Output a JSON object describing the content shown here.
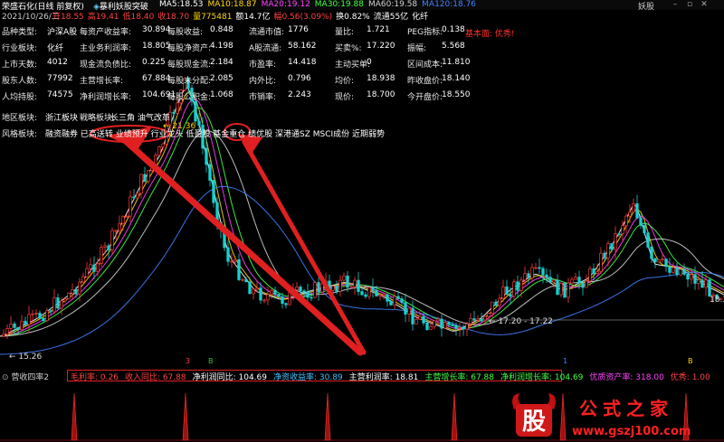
{
  "window": {
    "title": "荣盛石化(日线 前复权)",
    "formula_name": "暴利妖股突破",
    "ma": [
      {
        "label": "MA5:",
        "value": "18.53",
        "color": "#ffffff"
      },
      {
        "label": "MA10:",
        "value": "18.87",
        "color": "#ffd700"
      },
      {
        "label": "MA20:",
        "value": "19.12",
        "color": "#ff40ff"
      },
      {
        "label": "MA30:",
        "value": "19.88",
        "color": "#40ff40"
      },
      {
        "label": "MA60:",
        "value": "19.58",
        "color": "#d0d0d0"
      },
      {
        "label": "MA120:",
        "value": "18.76",
        "color": "#4080ff"
      }
    ],
    "app_name": "妖股",
    "buttons": [
      "minimize",
      "restore",
      "close"
    ]
  },
  "infobar": {
    "date": "2021/10/26/二",
    "items": [
      {
        "text": "开18.55",
        "color": "#ff4040"
      },
      {
        "text": "高19.41",
        "color": "#ff4040"
      },
      {
        "text": "低18.40",
        "color": "#ff4040"
      },
      {
        "text": "收18.70",
        "color": "#ff4040"
      },
      {
        "text": "量775481",
        "color": "#ffd700"
      },
      {
        "text": "额14.7亿",
        "color": "#ffffff"
      },
      {
        "text": "幅0.56(3.09%)",
        "color": "#ff4040"
      },
      {
        "text": "换0.82%",
        "color": "#ffffff"
      },
      {
        "text": "流通55亿",
        "color": "#ffffff"
      },
      {
        "text": "化纤",
        "color": "#ffffff"
      }
    ]
  },
  "fundamentals": {
    "rows": [
      [
        [
          "品种类型:",
          "沪深A股"
        ],
        [
          "每资产收益率:",
          "30.894"
        ],
        [
          "每股收益:",
          "0.848"
        ],
        [
          "流通市值:",
          "1776"
        ],
        [
          "量比:",
          "1.721"
        ],
        [
          "PEG指标:",
          "0.138"
        ]
      ],
      [
        [
          "行业板块:",
          "化纤"
        ],
        [
          "主业务利润率:",
          "18.805"
        ],
        [
          "每股净资产:",
          "4.198"
        ],
        [
          "A股流通:",
          "58.162"
        ],
        [
          "买卖%:",
          "17.220"
        ],
        [
          "振幅:",
          "5.568"
        ]
      ],
      [
        [
          "上市天数:",
          "4012"
        ],
        [
          "现金流负债比:",
          "0.225"
        ],
        [
          "每股现金流:",
          "2.184"
        ],
        [
          "市盈率:",
          "14.418"
        ],
        [
          "主动买单:",
          "0"
        ],
        [
          "区间成本:",
          "11.810"
        ]
      ],
      [
        [
          "股东人数:",
          "77992"
        ],
        [
          "主营增长率:",
          "67.884"
        ],
        [
          "每股未分配:",
          "2.085"
        ],
        [
          "内外比:",
          "0.796"
        ],
        [
          "均价:",
          "18.938"
        ],
        [
          "昨收盘价:",
          "18.140"
        ]
      ],
      [
        [
          "人均持股:",
          "74575"
        ],
        [
          "净利润增长率:",
          "104.691"
        ],
        [
          "每股公积金:",
          "1.068"
        ],
        [
          "市销率:",
          "2.243"
        ],
        [
          "现价:",
          "18.700"
        ],
        [
          "今开盘价:",
          "18.550"
        ]
      ]
    ],
    "region": {
      "label": "地区板块:",
      "value": "浙江板块",
      "strategy_label": "戦略板块:",
      "strategy_value": "长三角 油气改革"
    },
    "style": {
      "label": "风格板块:",
      "value": "融资融券 已高送转 业绩预升 行业龙头 低盈股 基金重仓 绩优股 深港通SZ MSCI成份 近期弱势"
    }
  },
  "basic_face": "基本面: 优秀!",
  "chart_data": {
    "type": "candlestick",
    "price_labels": [
      "21.36",
      "17.20 - 17.22",
      "15.26",
      "18.3"
    ],
    "markers": [
      "3",
      "1",
      "B",
      "B"
    ],
    "annotations": [
      "行业龙头",
      "绩优股"
    ]
  },
  "sub_indicator": {
    "name": "营收四率2",
    "items": [
      {
        "text": "毛利率: 0.26",
        "color": "#ff4040"
      },
      {
        "text": "收入同比: 67.88",
        "color": "#ff4040"
      },
      {
        "text": "净利润同比: 104.69",
        "color": "#ffffff"
      },
      {
        "text": "净资收益率: 30.89",
        "color": "#40c0ff"
      },
      {
        "text": "主营利润率: 18.81",
        "color": "#ffffff"
      },
      {
        "text": "主营增长率: 67.88",
        "color": "#40ff40"
      },
      {
        "text": "净利润增长率: 104.69",
        "color": "#40ff40"
      },
      {
        "text": "优质资产率: 318.00",
        "color": "#ff40ff"
      },
      {
        "text": "优秀: 1.00",
        "color": "#ff4040"
      }
    ]
  },
  "watermark": {
    "badge": "股",
    "title": "公式之家",
    "url": "www.gszj100.com"
  }
}
